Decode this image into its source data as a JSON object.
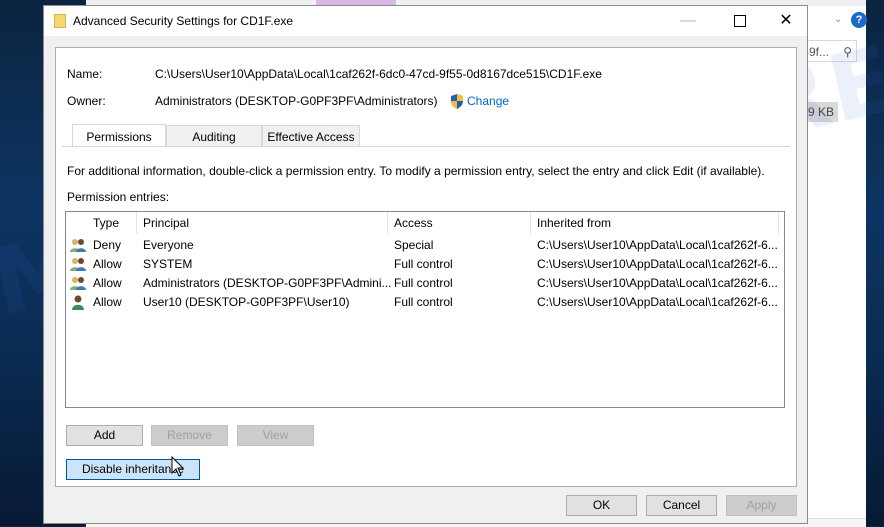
{
  "background": {
    "search_value": "-9f...",
    "size_value": "9 KB",
    "help_icon": "help-icon"
  },
  "dialog": {
    "title": "Advanced Security Settings for CD1F.exe",
    "name_label": "Name:",
    "name_value": "C:\\Users\\User10\\AppData\\Local\\1caf262f-6dc0-47cd-9f55-0d8167dce515\\CD1F.exe",
    "owner_label": "Owner:",
    "owner_value": "Administrators (DESKTOP-G0PF3PF\\Administrators)",
    "change_link": "Change",
    "tabs": [
      {
        "label": "Permissions",
        "active": true
      },
      {
        "label": "Auditing",
        "active": false
      },
      {
        "label": "Effective Access",
        "active": false
      }
    ],
    "info_text": "For additional information, double-click a permission entry. To modify a permission entry, select the entry and click Edit (if available).",
    "entries_label": "Permission entries:",
    "columns": [
      "Type",
      "Principal",
      "Access",
      "Inherited from"
    ],
    "rows": [
      {
        "icon": "group-icon",
        "type": "Deny",
        "principal": "Everyone",
        "access": "Special",
        "inherited": "C:\\Users\\User10\\AppData\\Local\\1caf262f-6..."
      },
      {
        "icon": "group-icon",
        "type": "Allow",
        "principal": "SYSTEM",
        "access": "Full control",
        "inherited": "C:\\Users\\User10\\AppData\\Local\\1caf262f-6..."
      },
      {
        "icon": "group-icon",
        "type": "Allow",
        "principal": "Administrators (DESKTOP-G0PF3PF\\Admini...",
        "access": "Full control",
        "inherited": "C:\\Users\\User10\\AppData\\Local\\1caf262f-6..."
      },
      {
        "icon": "user-icon",
        "type": "Allow",
        "principal": "User10 (DESKTOP-G0PF3PF\\User10)",
        "access": "Full control",
        "inherited": "C:\\Users\\User10\\AppData\\Local\\1caf262f-6..."
      }
    ],
    "buttons": {
      "add": "Add",
      "remove": "Remove",
      "view": "View",
      "disable_inheritance": "Disable inheritance",
      "ok": "OK",
      "cancel": "Cancel",
      "apply": "Apply"
    }
  },
  "watermark": "MYANTISPYWARE.COM"
}
